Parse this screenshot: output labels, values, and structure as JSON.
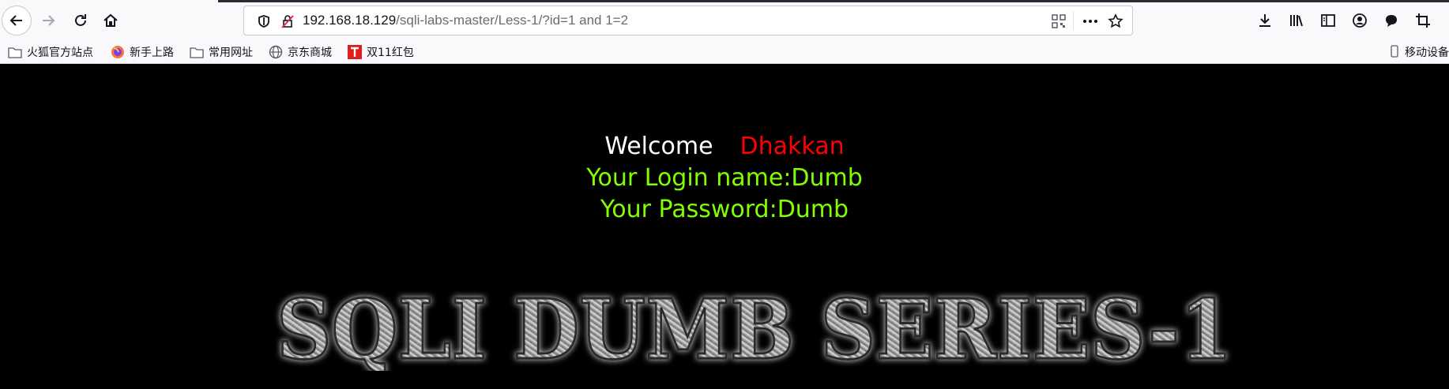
{
  "browser": {
    "url_host": "192.168.18.129",
    "url_path": "/sqli-labs-master/Less-1/?id=1 and 1=2",
    "icons": {
      "back": "back-arrow-icon",
      "forward": "forward-arrow-icon",
      "reload": "reload-icon",
      "home": "home-icon",
      "shield": "tracking-shield-icon",
      "insecure": "insecure-connection-icon",
      "qr": "qr-code-icon",
      "more": "more-actions-icon",
      "bookmark_star": "star-icon",
      "right": [
        "download-icon",
        "library-icon",
        "sidebar-icon",
        "account-icon",
        "chat-icon",
        "crop-icon"
      ]
    }
  },
  "bookmarks": {
    "items": [
      {
        "label": "火狐官方站点",
        "icon": "folder-icon"
      },
      {
        "label": "新手上路",
        "icon": "firefox-icon"
      },
      {
        "label": "常用网址",
        "icon": "folder-icon"
      },
      {
        "label": "京东商城",
        "icon": "globe-icon"
      },
      {
        "label": "双11红包",
        "icon": "tmall-icon"
      }
    ],
    "mobile": {
      "label": "移动设备",
      "icon": "mobile-device-icon"
    }
  },
  "page": {
    "welcome": "Welcome",
    "name": "Dhakkan",
    "login_line": "Your Login name:Dumb",
    "password_line": "Your Password:Dumb",
    "banner_text": "SQLI DUMB SERIES-1",
    "colors": {
      "welcome": "#ffffff",
      "name": "#ff0000",
      "info": "#7fff00",
      "background": "#000000"
    }
  }
}
